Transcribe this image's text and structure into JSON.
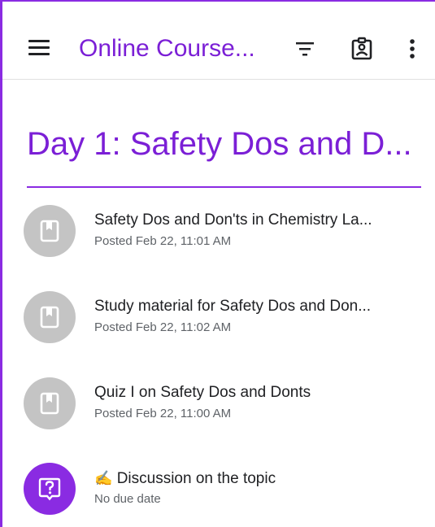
{
  "header": {
    "title": "Online Course...",
    "icons": [
      "menu-icon",
      "filter-icon",
      "classwork-icon",
      "more-vert-icon"
    ]
  },
  "topic": {
    "title": "Day 1: Safety Dos and D..."
  },
  "items": [
    {
      "title": "Safety Dos and Don'ts in Chemistry La...",
      "subtitle": "Posted Feb 22, 11:01 AM",
      "icon": "material-icon",
      "avatar_color": "#c4c4c4"
    },
    {
      "title": "Study material for Safety Dos and Don...",
      "subtitle": "Posted Feb 22, 11:02 AM",
      "icon": "material-icon",
      "avatar_color": "#c4c4c4"
    },
    {
      "title": "Quiz I on Safety Dos and Donts",
      "subtitle": "Posted Feb 22, 11:00 AM",
      "icon": "material-icon",
      "avatar_color": "#c4c4c4"
    },
    {
      "emoji": "✍️",
      "title": "Discussion on the topic",
      "subtitle": "No due date",
      "icon": "question-icon",
      "avatar_color": "#8a2be2"
    }
  ],
  "colors": {
    "accent": "#7b1fd6",
    "border": "#8a2be2",
    "text": "#202124",
    "secondary_text": "#5f6368",
    "gray_avatar": "#c4c4c4"
  }
}
